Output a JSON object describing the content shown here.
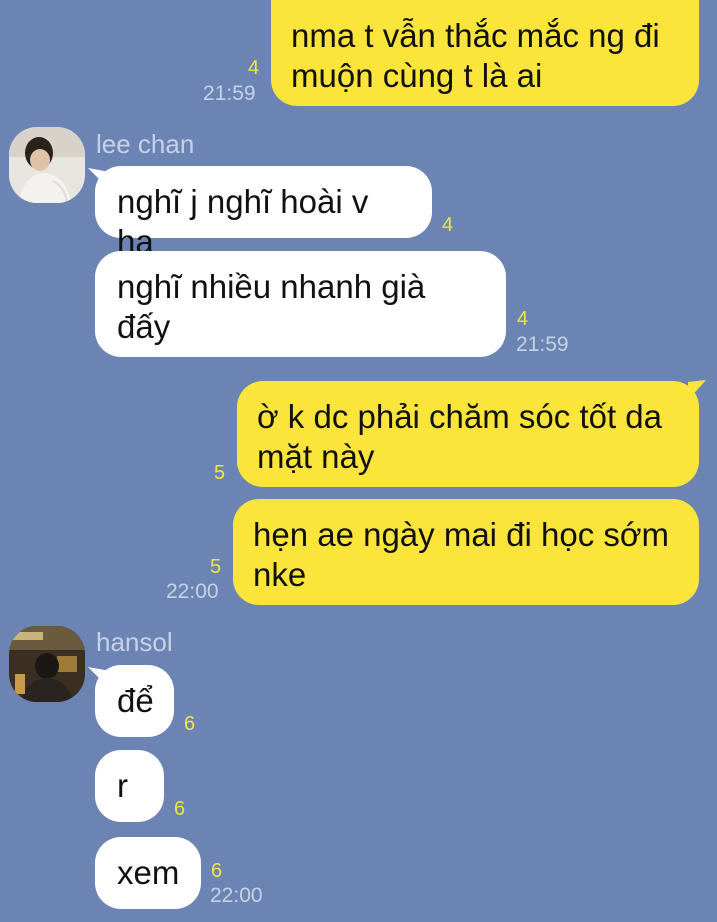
{
  "messages": [
    {
      "id": "m1",
      "side": "me",
      "text": "nma t vẫn thắc mắc ng đi\nmuộn cùng t là ai",
      "read": "4",
      "time": "21:59"
    },
    {
      "id": "m2",
      "side": "them",
      "sender": "lee chan",
      "text": "nghĩ j nghĩ hoài v ha",
      "read": "4"
    },
    {
      "id": "m3",
      "side": "them",
      "text": "nghĩ nhiều nhanh già\nđấy",
      "read": "4",
      "time": "21:59"
    },
    {
      "id": "m4",
      "side": "me",
      "text": "ờ k dc phải chăm sóc tốt da\nmặt này",
      "read": "5"
    },
    {
      "id": "m5",
      "side": "me",
      "text": "hẹn ae ngày mai đi học sớm\nnke",
      "read": "5",
      "time": "22:00"
    },
    {
      "id": "m6",
      "side": "them",
      "sender": "hansol",
      "text": "để",
      "read": "6"
    },
    {
      "id": "m7",
      "side": "them",
      "text": "r",
      "read": "6"
    },
    {
      "id": "m8",
      "side": "them",
      "text": "xem",
      "read": "6",
      "time": "22:00"
    }
  ],
  "colors": {
    "background": "#6b84b3",
    "my_bubble": "#fbe53b",
    "their_bubble": "#ffffff",
    "read_count": "#f2e43f",
    "meta_text": "#c6d1e6"
  },
  "icons": {
    "avatar_lee_chan": "avatar-photo",
    "avatar_hansol": "avatar-photo"
  }
}
